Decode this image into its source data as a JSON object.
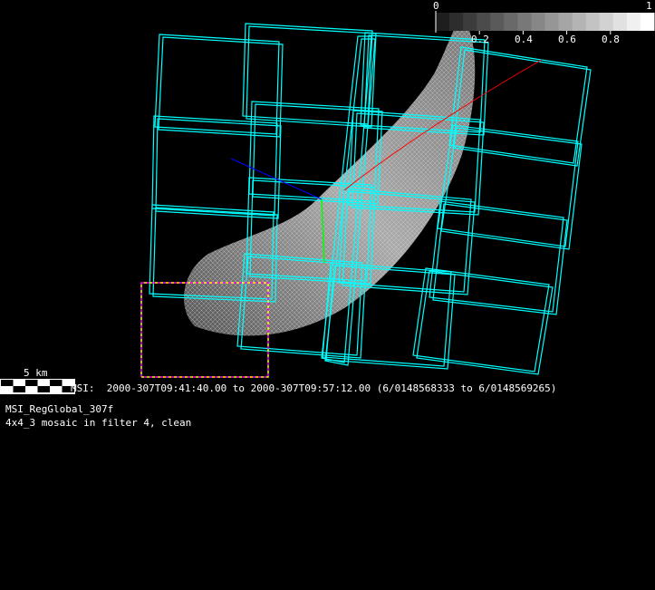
{
  "colorbar": {
    "min_label": "0",
    "max_label": "1",
    "tick_labels": [
      "0.2",
      "0.4",
      "0.6",
      "0.8"
    ],
    "steps": 16
  },
  "scale_bar": {
    "label": "5 km"
  },
  "time_range": "MSI:  2000-307T09:41:40.00 to 2000-307T09:57:12.00 (6/0148568333 to 6/0148569265)",
  "title": "MSI_RegGlobal_307f",
  "subtitle": "4x4_3 mosaic in filter 4, clean",
  "colors": {
    "footprint": "#00ffff",
    "highlight_a": "#ff00ff",
    "highlight_b": "#ffff00",
    "track": "#ff0000",
    "axis_blue": "#0000ff",
    "axis_green": "#00ff00"
  }
}
